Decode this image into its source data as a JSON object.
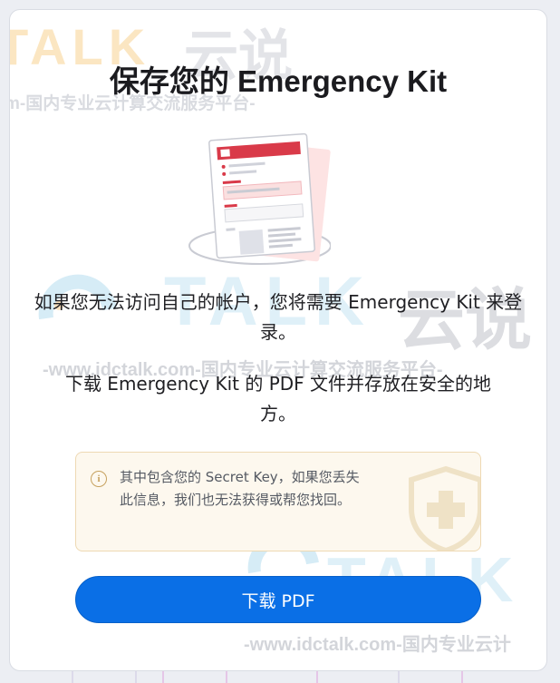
{
  "dialog": {
    "title": "保存您的 Emergency Kit",
    "paragraph1": "如果您无法访问自己的帐户，您将需要 Emergency Kit 来登录。",
    "paragraph2": "下载 Emergency Kit 的 PDF 文件并存放在安全的地方。",
    "notice": {
      "icon": "info-icon",
      "text": "其中包含您的 Secret Key，如果您丢失此信息，我们也无法获得或帮您找回。"
    },
    "download_button_label": "下载 PDF"
  },
  "watermark": {
    "brand_text": "云说",
    "letters": "TALK",
    "slogan": "-www.idctalk.com-国内专业云计算交流服务平台-",
    "slogan_partial": "m-国内专业云计算交流服务平台-",
    "slogan_bottom": "-www.idctalk.com-国内专业云计"
  },
  "colors": {
    "accent": "#0a6fe6",
    "notice_bg": "#fdf8ee",
    "notice_border": "#eed9b3",
    "kit_red": "#d93a49"
  }
}
